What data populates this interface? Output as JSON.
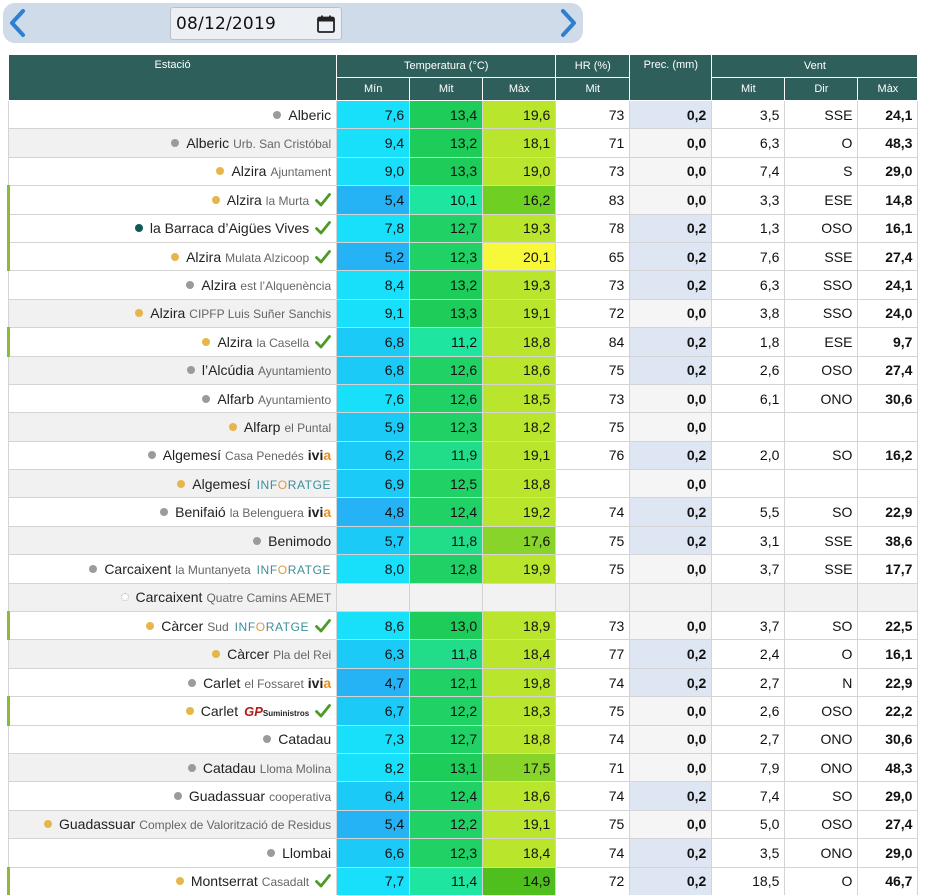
{
  "date_picker": {
    "value": "08/12/2019",
    "prev_icon": "chevron-left-icon",
    "next_icon": "chevron-right-icon",
    "calendar_icon": "calendar-icon"
  },
  "colors": {
    "header": "#2f5f5a",
    "topbar": "#cfdbe8",
    "check": "#4e9a27",
    "highlight_border": "#8bb93a"
  },
  "table": {
    "headers": {
      "station": "Estació",
      "temperature": "Temperatura (°C)",
      "hr": "HR (%)",
      "prec": "Prec. (mm)",
      "wind": "Vent",
      "tmin": "Mín",
      "tmit": "Mit",
      "tmax": "Màx",
      "hrmit": "Mit",
      "wmit": "Mit",
      "wdir": "Dir",
      "wmax": "Màx"
    },
    "rows": [
      {
        "name": "Alberic",
        "sub": "",
        "logo": "",
        "check": false,
        "dot": "gray",
        "hl": false,
        "tmin": "7,6",
        "tmit": "13,4",
        "tmax": "19,6",
        "hr": "73",
        "prec": "0,2",
        "wmit": "3,5",
        "wdir": "SSE",
        "wmax": "24,1"
      },
      {
        "name": "Alberic",
        "sub": "Urb. San Cristóbal",
        "logo": "",
        "check": false,
        "dot": "gray",
        "hl": false,
        "tmin": "9,4",
        "tmit": "13,2",
        "tmax": "18,1",
        "hr": "71",
        "prec": "0,0",
        "wmit": "6,3",
        "wdir": "O",
        "wmax": "48,3"
      },
      {
        "name": "Alzira",
        "sub": "Ajuntament",
        "logo": "",
        "check": false,
        "dot": "orange",
        "hl": false,
        "tmin": "9,0",
        "tmit": "13,3",
        "tmax": "19,0",
        "hr": "73",
        "prec": "0,0",
        "wmit": "7,4",
        "wdir": "S",
        "wmax": "29,0"
      },
      {
        "name": "Alzira",
        "sub": "la Murta",
        "logo": "",
        "check": true,
        "dot": "orange",
        "hl": true,
        "tmin": "5,4",
        "tmit": "10,1",
        "tmax": "16,2",
        "hr": "83",
        "prec": "0,0",
        "wmit": "3,3",
        "wdir": "ESE",
        "wmax": "14,8"
      },
      {
        "name": "la Barraca d’Aigües Vives",
        "sub": "",
        "logo": "",
        "check": true,
        "dot": "teal",
        "hl": true,
        "tmin": "7,8",
        "tmit": "12,7",
        "tmax": "19,3",
        "hr": "78",
        "prec": "0,2",
        "wmit": "1,3",
        "wdir": "OSO",
        "wmax": "16,1"
      },
      {
        "name": "Alzira",
        "sub": "Mulata Alzicoop",
        "logo": "",
        "check": true,
        "dot": "orange",
        "hl": true,
        "tmin": "5,2",
        "tmit": "12,3",
        "tmax": "20,1",
        "hr": "65",
        "prec": "0,2",
        "wmit": "7,6",
        "wdir": "SSE",
        "wmax": "27,4"
      },
      {
        "name": "Alzira",
        "sub": "est l’Alquenència",
        "logo": "",
        "check": false,
        "dot": "gray",
        "hl": false,
        "tmin": "8,4",
        "tmit": "13,2",
        "tmax": "19,3",
        "hr": "73",
        "prec": "0,2",
        "wmit": "6,3",
        "wdir": "SSO",
        "wmax": "24,1"
      },
      {
        "name": "Alzira",
        "sub": "CIPFP Luis Suñer Sanchis",
        "logo": "",
        "check": false,
        "dot": "orange",
        "hl": false,
        "tmin": "9,1",
        "tmit": "13,3",
        "tmax": "19,1",
        "hr": "72",
        "prec": "0,0",
        "wmit": "3,8",
        "wdir": "SSO",
        "wmax": "24,0"
      },
      {
        "name": "Alzira",
        "sub": "la Casella",
        "logo": "",
        "check": true,
        "dot": "orange",
        "hl": true,
        "tmin": "6,8",
        "tmit": "11,2",
        "tmax": "18,8",
        "hr": "84",
        "prec": "0,2",
        "wmit": "1,8",
        "wdir": "ESE",
        "wmax": "9,7"
      },
      {
        "name": "l’Alcúdia",
        "sub": "Ayuntamiento",
        "logo": "",
        "check": false,
        "dot": "gray",
        "hl": false,
        "tmin": "6,8",
        "tmit": "12,6",
        "tmax": "18,6",
        "hr": "75",
        "prec": "0,2",
        "wmit": "2,6",
        "wdir": "OSO",
        "wmax": "27,4"
      },
      {
        "name": "Alfarb",
        "sub": "Ayuntamiento",
        "logo": "",
        "check": false,
        "dot": "gray",
        "hl": false,
        "tmin": "7,6",
        "tmit": "12,6",
        "tmax": "18,5",
        "hr": "73",
        "prec": "0,0",
        "wmit": "6,1",
        "wdir": "ONO",
        "wmax": "30,6"
      },
      {
        "name": "Alfarp",
        "sub": "el Puntal",
        "logo": "",
        "check": false,
        "dot": "orange",
        "hl": false,
        "tmin": "5,9",
        "tmit": "12,3",
        "tmax": "18,2",
        "hr": "75",
        "prec": "0,0",
        "wmit": "",
        "wdir": "",
        "wmax": ""
      },
      {
        "name": "Algemesí",
        "sub": "Casa Penedés",
        "logo": "ivia",
        "check": false,
        "dot": "gray",
        "hl": false,
        "tmin": "6,2",
        "tmit": "11,9",
        "tmax": "19,1",
        "hr": "76",
        "prec": "0,2",
        "wmit": "2,0",
        "wdir": "SO",
        "wmax": "16,2"
      },
      {
        "name": "Algemesí",
        "sub": "",
        "logo": "inforatge",
        "check": false,
        "dot": "orange",
        "hl": false,
        "tmin": "6,9",
        "tmit": "12,5",
        "tmax": "18,8",
        "hr": "",
        "prec": "0,0",
        "wmit": "",
        "wdir": "",
        "wmax": ""
      },
      {
        "name": "Benifaió",
        "sub": "la Belenguera",
        "logo": "ivia",
        "check": false,
        "dot": "gray",
        "hl": false,
        "tmin": "4,8",
        "tmit": "12,4",
        "tmax": "19,2",
        "hr": "74",
        "prec": "0,2",
        "wmit": "5,5",
        "wdir": "SO",
        "wmax": "22,9"
      },
      {
        "name": "Benimodo",
        "sub": "",
        "logo": "",
        "check": false,
        "dot": "gray",
        "hl": false,
        "tmin": "5,7",
        "tmit": "11,8",
        "tmax": "17,6",
        "hr": "75",
        "prec": "0,2",
        "wmit": "3,1",
        "wdir": "SSE",
        "wmax": "38,6"
      },
      {
        "name": "Carcaixent",
        "sub": "la Muntanyeta",
        "logo": "inforatge",
        "check": false,
        "dot": "gray",
        "hl": false,
        "tmin": "8,0",
        "tmit": "12,8",
        "tmax": "19,9",
        "hr": "75",
        "prec": "0,0",
        "wmit": "3,7",
        "wdir": "SSE",
        "wmax": "17,7"
      },
      {
        "name": "Carcaixent",
        "sub": "Quatre Camins AEMET",
        "logo": "",
        "check": false,
        "dot": "empty",
        "hl": false,
        "tmin": "",
        "tmit": "",
        "tmax": "",
        "hr": "",
        "prec": "",
        "wmit": "",
        "wdir": "",
        "wmax": ""
      },
      {
        "name": "Càrcer",
        "sub": "Sud",
        "logo": "inforatge",
        "check": true,
        "dot": "orange",
        "hl": true,
        "tmin": "8,6",
        "tmit": "13,0",
        "tmax": "18,9",
        "hr": "73",
        "prec": "0,0",
        "wmit": "3,7",
        "wdir": "SO",
        "wmax": "22,5"
      },
      {
        "name": "Càrcer",
        "sub": "Pla del Rei",
        "logo": "",
        "check": false,
        "dot": "orange",
        "hl": false,
        "tmin": "6,3",
        "tmit": "11,8",
        "tmax": "18,4",
        "hr": "77",
        "prec": "0,2",
        "wmit": "2,4",
        "wdir": "O",
        "wmax": "16,1"
      },
      {
        "name": "Carlet",
        "sub": "el Fossaret",
        "logo": "ivia",
        "check": false,
        "dot": "gray",
        "hl": false,
        "tmin": "4,7",
        "tmit": "12,1",
        "tmax": "19,8",
        "hr": "74",
        "prec": "0,2",
        "wmit": "2,7",
        "wdir": "N",
        "wmax": "22,9"
      },
      {
        "name": "Carlet",
        "sub": "",
        "logo": "gp",
        "check": true,
        "dot": "orange",
        "hl": true,
        "tmin": "6,7",
        "tmit": "12,2",
        "tmax": "18,3",
        "hr": "75",
        "prec": "0,0",
        "wmit": "2,6",
        "wdir": "OSO",
        "wmax": "22,2"
      },
      {
        "name": "Catadau",
        "sub": "",
        "logo": "",
        "check": false,
        "dot": "gray",
        "hl": false,
        "tmin": "7,3",
        "tmit": "12,7",
        "tmax": "18,8",
        "hr": "74",
        "prec": "0,0",
        "wmit": "2,7",
        "wdir": "ONO",
        "wmax": "30,6"
      },
      {
        "name": "Catadau",
        "sub": "Lloma Molina",
        "logo": "",
        "check": false,
        "dot": "gray",
        "hl": false,
        "tmin": "8,2",
        "tmit": "13,1",
        "tmax": "17,5",
        "hr": "71",
        "prec": "0,0",
        "wmit": "7,9",
        "wdir": "ONO",
        "wmax": "48,3"
      },
      {
        "name": "Guadassuar",
        "sub": "cooperativa",
        "logo": "",
        "check": false,
        "dot": "gray",
        "hl": false,
        "tmin": "6,4",
        "tmit": "12,4",
        "tmax": "18,6",
        "hr": "74",
        "prec": "0,2",
        "wmit": "7,4",
        "wdir": "SO",
        "wmax": "29,0"
      },
      {
        "name": "Guadassuar",
        "sub": "Complex de Valorització de Residus",
        "logo": "",
        "check": false,
        "dot": "orange",
        "hl": false,
        "tmin": "5,4",
        "tmit": "12,2",
        "tmax": "19,1",
        "hr": "75",
        "prec": "0,0",
        "wmit": "5,0",
        "wdir": "OSO",
        "wmax": "27,4"
      },
      {
        "name": "Llombai",
        "sub": "",
        "logo": "",
        "check": false,
        "dot": "gray",
        "hl": false,
        "tmin": "6,6",
        "tmit": "12,3",
        "tmax": "18,4",
        "hr": "74",
        "prec": "0,2",
        "wmit": "3,5",
        "wdir": "ONO",
        "wmax": "29,0"
      },
      {
        "name": "Montserrat",
        "sub": "Casadalt",
        "logo": "",
        "check": true,
        "dot": "orange",
        "hl": true,
        "tmin": "7,7",
        "tmit": "11,4",
        "tmax": "14,9",
        "hr": "72",
        "prec": "0,2",
        "wmit": "18,5",
        "wdir": "O",
        "wmax": "46,7"
      }
    ]
  },
  "logos": {
    "ivia": {
      "main": "ivi",
      "accent": "a"
    },
    "inforatge": {
      "pre": "INF",
      "o": "O",
      "post": "RATGE"
    },
    "gp": {
      "main": "GP",
      "small": "Suministros"
    }
  }
}
